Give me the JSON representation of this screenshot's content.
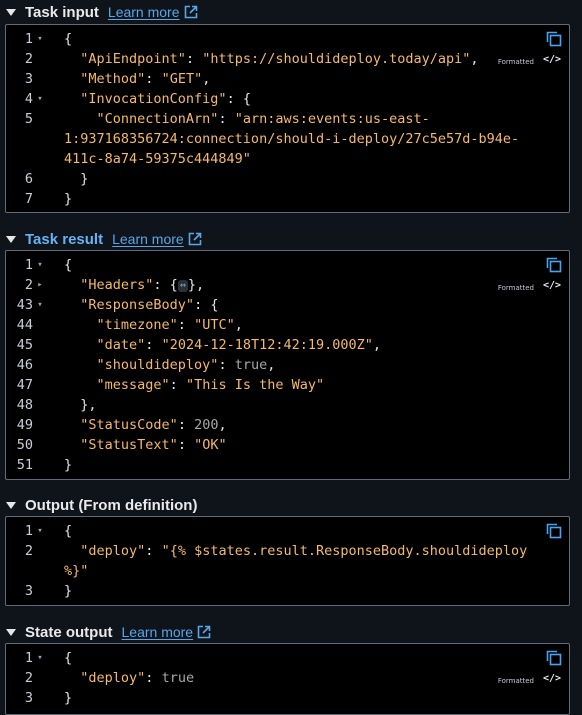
{
  "sections": [
    {
      "title": "Task input",
      "learn_more": "Learn more",
      "formatted_label": "Formatted",
      "lines": [
        {
          "n": "1",
          "fold": "▾",
          "tokens": [
            [
              "p",
              "{"
            ]
          ]
        },
        {
          "n": "2",
          "fold": "",
          "tokens": [
            [
              "p",
              "  "
            ],
            [
              "k",
              "\"ApiEndpoint\""
            ],
            [
              "p",
              ": "
            ],
            [
              "s",
              "\"https://shouldideploy.today/api\""
            ],
            [
              "p",
              ","
            ]
          ]
        },
        {
          "n": "3",
          "fold": "",
          "tokens": [
            [
              "p",
              "  "
            ],
            [
              "k",
              "\"Method\""
            ],
            [
              "p",
              ": "
            ],
            [
              "s",
              "\"GET\""
            ],
            [
              "p",
              ","
            ]
          ]
        },
        {
          "n": "4",
          "fold": "▾",
          "tokens": [
            [
              "p",
              "  "
            ],
            [
              "k",
              "\"InvocationConfig\""
            ],
            [
              "p",
              ": {"
            ]
          ]
        },
        {
          "n": "5",
          "fold": "",
          "tokens": [
            [
              "p",
              "    "
            ],
            [
              "k",
              "\"ConnectionArn\""
            ],
            [
              "p",
              ": "
            ],
            [
              "s",
              "\"arn:aws:events:us-east-"
            ]
          ]
        },
        {
          "n": "",
          "fold": "",
          "tokens": [
            [
              "s",
              "1:937168356724:connection/should-i-deploy/27c5e57d-b94e-"
            ]
          ]
        },
        {
          "n": "",
          "fold": "",
          "tokens": [
            [
              "s",
              "411c-8a74-59375c444849\""
            ]
          ]
        },
        {
          "n": "6",
          "fold": "",
          "tokens": [
            [
              "p",
              "  }"
            ]
          ]
        },
        {
          "n": "7",
          "fold": "",
          "tokens": [
            [
              "p",
              "}"
            ]
          ]
        }
      ]
    },
    {
      "title": "Task result",
      "learn_more": "Learn more",
      "formatted_label": "Formatted",
      "lines": [
        {
          "n": "1",
          "fold": "▾",
          "tokens": [
            [
              "p",
              "{"
            ]
          ]
        },
        {
          "n": "2",
          "fold": "▸",
          "tokens": [
            [
              "p",
              "  "
            ],
            [
              "k",
              "\"Headers\""
            ],
            [
              "p",
              ": {"
            ],
            [
              "pill",
              "⇔"
            ],
            [
              "p",
              "},"
            ]
          ]
        },
        {
          "n": "43",
          "fold": "▾",
          "tokens": [
            [
              "p",
              "  "
            ],
            [
              "k",
              "\"ResponseBody\""
            ],
            [
              "p",
              ": {"
            ]
          ]
        },
        {
          "n": "44",
          "fold": "",
          "tokens": [
            [
              "p",
              "    "
            ],
            [
              "k",
              "\"timezone\""
            ],
            [
              "p",
              ": "
            ],
            [
              "s",
              "\"UTC\""
            ],
            [
              "p",
              ","
            ]
          ]
        },
        {
          "n": "45",
          "fold": "",
          "tokens": [
            [
              "p",
              "    "
            ],
            [
              "k",
              "\"date\""
            ],
            [
              "p",
              ": "
            ],
            [
              "s",
              "\"2024-12-18T12:42:19.000Z\""
            ],
            [
              "p",
              ","
            ]
          ]
        },
        {
          "n": "46",
          "fold": "",
          "tokens": [
            [
              "p",
              "    "
            ],
            [
              "k",
              "\"shouldideploy\""
            ],
            [
              "p",
              ": "
            ],
            [
              "n",
              "true"
            ],
            [
              "p",
              ","
            ]
          ]
        },
        {
          "n": "47",
          "fold": "",
          "tokens": [
            [
              "p",
              "    "
            ],
            [
              "k",
              "\"message\""
            ],
            [
              "p",
              ": "
            ],
            [
              "s",
              "\"This Is the Way\""
            ]
          ]
        },
        {
          "n": "48",
          "fold": "",
          "tokens": [
            [
              "p",
              "  },"
            ]
          ]
        },
        {
          "n": "49",
          "fold": "",
          "tokens": [
            [
              "p",
              "  "
            ],
            [
              "k",
              "\"StatusCode\""
            ],
            [
              "p",
              ": "
            ],
            [
              "n",
              "200"
            ],
            [
              "p",
              ","
            ]
          ]
        },
        {
          "n": "50",
          "fold": "",
          "tokens": [
            [
              "p",
              "  "
            ],
            [
              "k",
              "\"StatusText\""
            ],
            [
              "p",
              ": "
            ],
            [
              "s",
              "\"OK\""
            ]
          ]
        },
        {
          "n": "51",
          "fold": "",
          "tokens": [
            [
              "p",
              "}"
            ]
          ]
        }
      ]
    },
    {
      "title": "Output (From definition)",
      "learn_more": "",
      "formatted_label": "",
      "lines": [
        {
          "n": "1",
          "fold": "▾",
          "tokens": [
            [
              "p",
              "{"
            ]
          ]
        },
        {
          "n": "2",
          "fold": "",
          "tokens": [
            [
              "p",
              "  "
            ],
            [
              "k",
              "\"deploy\""
            ],
            [
              "p",
              ": "
            ],
            [
              "s",
              "\"{% $states.result.ResponseBody.shouldideploy"
            ]
          ]
        },
        {
          "n": "",
          "fold": "",
          "tokens": [
            [
              "s",
              "%}\""
            ]
          ]
        },
        {
          "n": "3",
          "fold": "",
          "tokens": [
            [
              "p",
              "}"
            ]
          ]
        }
      ]
    },
    {
      "title": "State output",
      "learn_more": "Learn more",
      "formatted_label": "Formatted",
      "lines": [
        {
          "n": "1",
          "fold": "▾",
          "tokens": [
            [
              "p",
              "{"
            ]
          ]
        },
        {
          "n": "2",
          "fold": "",
          "tokens": [
            [
              "p",
              "  "
            ],
            [
              "k",
              "\"deploy\""
            ],
            [
              "p",
              ": "
            ],
            [
              "n",
              "true"
            ]
          ]
        },
        {
          "n": "3",
          "fold": "",
          "tokens": [
            [
              "p",
              "}"
            ]
          ]
        }
      ]
    }
  ],
  "colors": {
    "background": "#0f141a",
    "panel": "#000000",
    "json_key": "#f5b96a",
    "json_string": "#f5b96a",
    "json_literal": "#a7a7a7",
    "link": "#58a6e8",
    "active_title": "#66b2f2"
  },
  "icons": [
    "chevron-down-icon",
    "external-link-icon",
    "copy-icon",
    "code-view-icon"
  ]
}
